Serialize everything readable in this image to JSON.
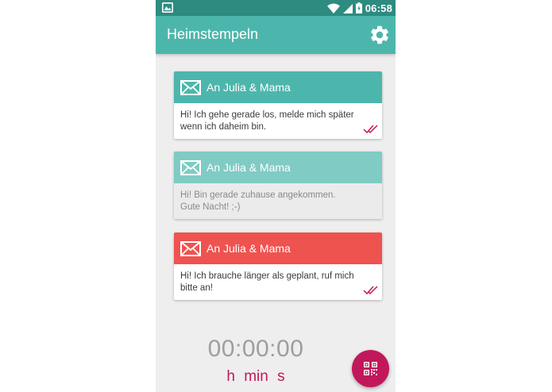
{
  "status_bar": {
    "time": "06:58",
    "icons": [
      "gallery-notification-icon",
      "wifi-icon",
      "signal-icon",
      "battery-icon"
    ]
  },
  "app_bar": {
    "title": "Heimstempeln",
    "settings_icon": "gear-icon"
  },
  "colors": {
    "status_bar": "#2e8b80",
    "app_bar": "#4db6ac",
    "card_teal": "#4db6ac",
    "card_teal_faded": "#80cbc4",
    "card_red": "#ef5350",
    "accent": "#c2185b",
    "timer": "#9e9e9e",
    "background": "#eeeeee"
  },
  "messages": [
    {
      "recipient": "An Julia & Mama",
      "text": "Hi! Ich gehe gerade los, melde mich später wenn ich daheim bin.",
      "header_color": "#4db6ac",
      "icon": "mail-icon",
      "sent_icon": "double-check-icon",
      "sent": true
    },
    {
      "recipient": "An Julia & Mama",
      "text": "Hi! Bin gerade zuhause angekommen. Gute Nacht! ;-)",
      "header_color": "#80cbc4",
      "icon": "mail-icon",
      "sent": false
    },
    {
      "recipient": "An Julia & Mama",
      "text": "Hi! Ich brauche länger als geplant, ruf mich bitte an!",
      "header_color": "#ef5350",
      "icon": "mail-icon",
      "sent_icon": "double-check-icon",
      "sent": true
    }
  ],
  "timer": {
    "value": "00:00:00",
    "unit_h": "h",
    "unit_min": "min",
    "unit_s": "s"
  },
  "fab": {
    "icon": "qr-code-icon"
  }
}
